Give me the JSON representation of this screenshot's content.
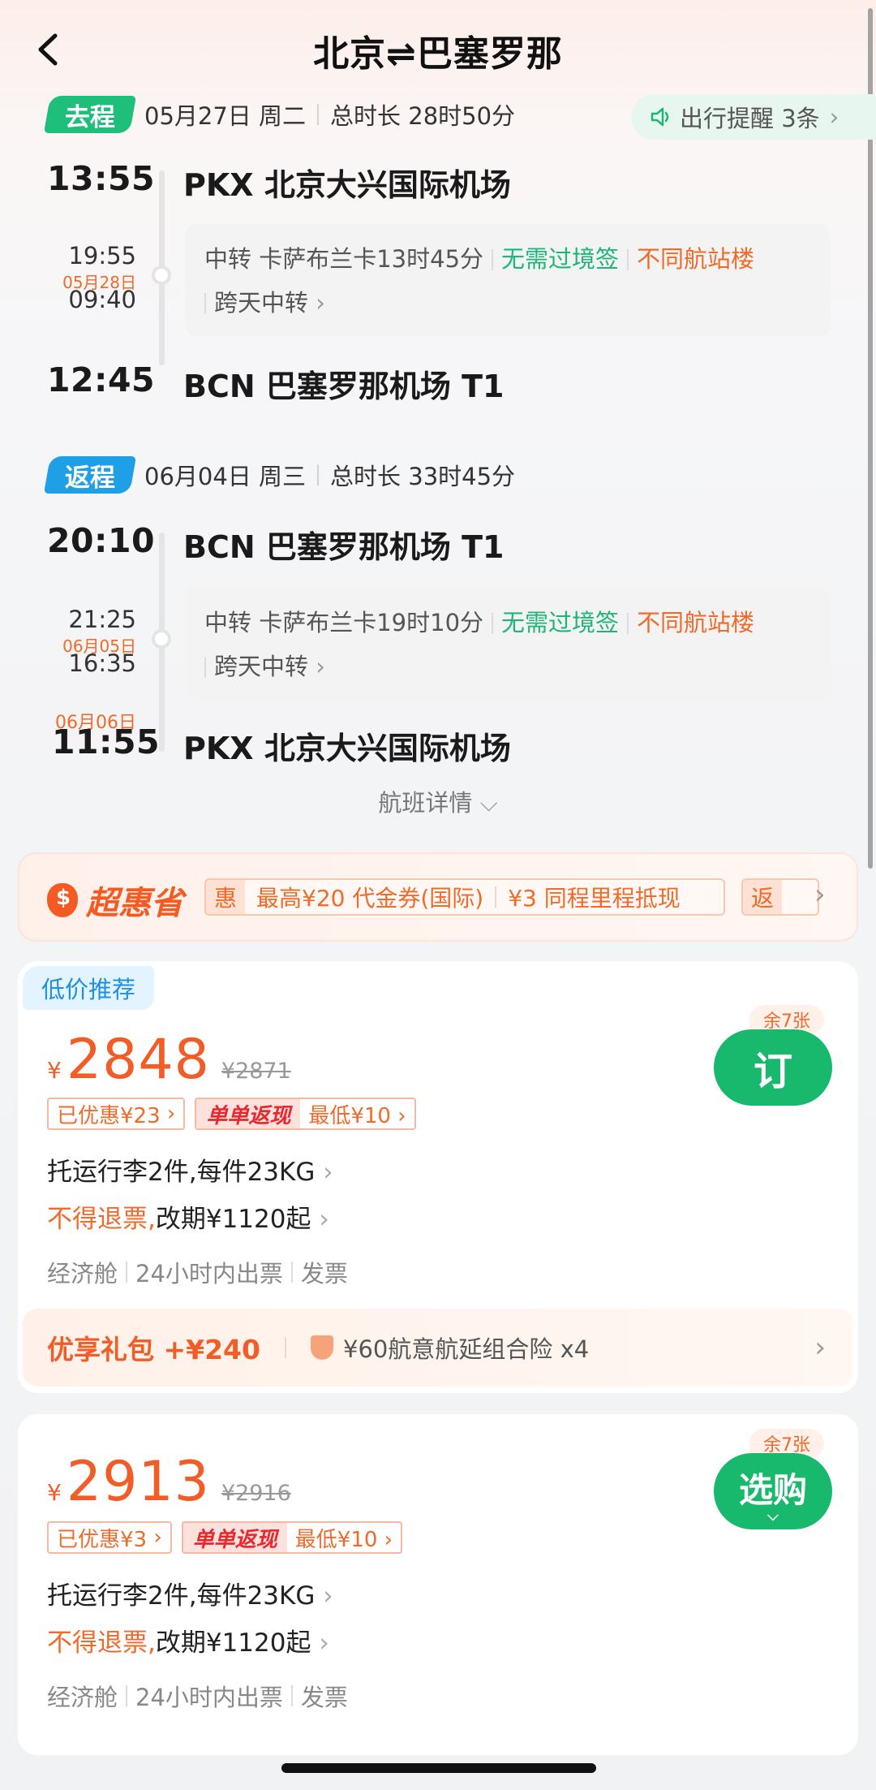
{
  "header": {
    "title": "北京⇌巴塞罗那"
  },
  "outbound": {
    "tag": "去程",
    "date": "05月27日 周二",
    "duration": "总时长 28时50分",
    "reminder": "出行提醒 3条",
    "dep_time": "13:55",
    "dep_airport": "PKX 北京大兴国际机场",
    "transfer_arr": "19:55",
    "transfer_date": "05月28日",
    "transfer_dep": "09:40",
    "transfer_city": "中转 卡萨布兰卡13时45分",
    "transfer_visa": "无需过境签",
    "transfer_terminal": "不同航站楼",
    "transfer_note": "跨天中转",
    "arr_time": "12:45",
    "arr_airport": "BCN 巴塞罗那机场 T1"
  },
  "inbound": {
    "tag": "返程",
    "date": "06月04日 周三",
    "duration": "总时长 33时45分",
    "dep_time": "20:10",
    "dep_airport": "BCN 巴塞罗那机场 T1",
    "transfer_arr": "21:25",
    "transfer_date": "06月05日",
    "transfer_dep": "16:35",
    "transfer_city": "中转 卡萨布兰卡19时10分",
    "transfer_visa": "无需过境签",
    "transfer_terminal": "不同航站楼",
    "transfer_note": "跨天中转",
    "arr_date": "06月06日",
    "arr_time": "11:55",
    "arr_airport": "PKX 北京大兴国际机场"
  },
  "details_link": "航班详情",
  "promo": {
    "logo": "超惠省",
    "badge": "惠",
    "text": "最高¥20 代金券(国际)",
    "text2": "¥3 同程里程抵现",
    "badge2": "返"
  },
  "offers": [
    {
      "tag": "低价推荐",
      "currency": "¥",
      "price": "2848",
      "old_price": "¥2871",
      "discount": "已优惠¥23",
      "cashback_label": "单单返现",
      "cashback_value": "最低¥10",
      "baggage": "托运行李2件,每件23KG",
      "refund": "不得退票,",
      "change": "改期¥1120起",
      "cabin": "经济舱",
      "issue": "24小时内出票",
      "invoice": "发票",
      "button": "订",
      "stock": "余7张",
      "gift_label": "优享礼包 +¥240",
      "gift_text": "¥60航意航延组合险 x4"
    },
    {
      "currency": "¥",
      "price": "2913",
      "old_price": "¥2916",
      "discount": "已优惠¥3",
      "cashback_label": "单单返现",
      "cashback_value": "最低¥10",
      "baggage": "托运行李2件,每件23KG",
      "refund": "不得退票,",
      "change": "改期¥1120起",
      "cabin": "经济舱",
      "issue": "24小时内出票",
      "invoice": "发票",
      "button": "选购",
      "stock": "余7张"
    }
  ],
  "colors": {
    "accent_green": "#18b86d",
    "accent_orange": "#f25c27",
    "accent_blue": "#1e9fe6"
  }
}
